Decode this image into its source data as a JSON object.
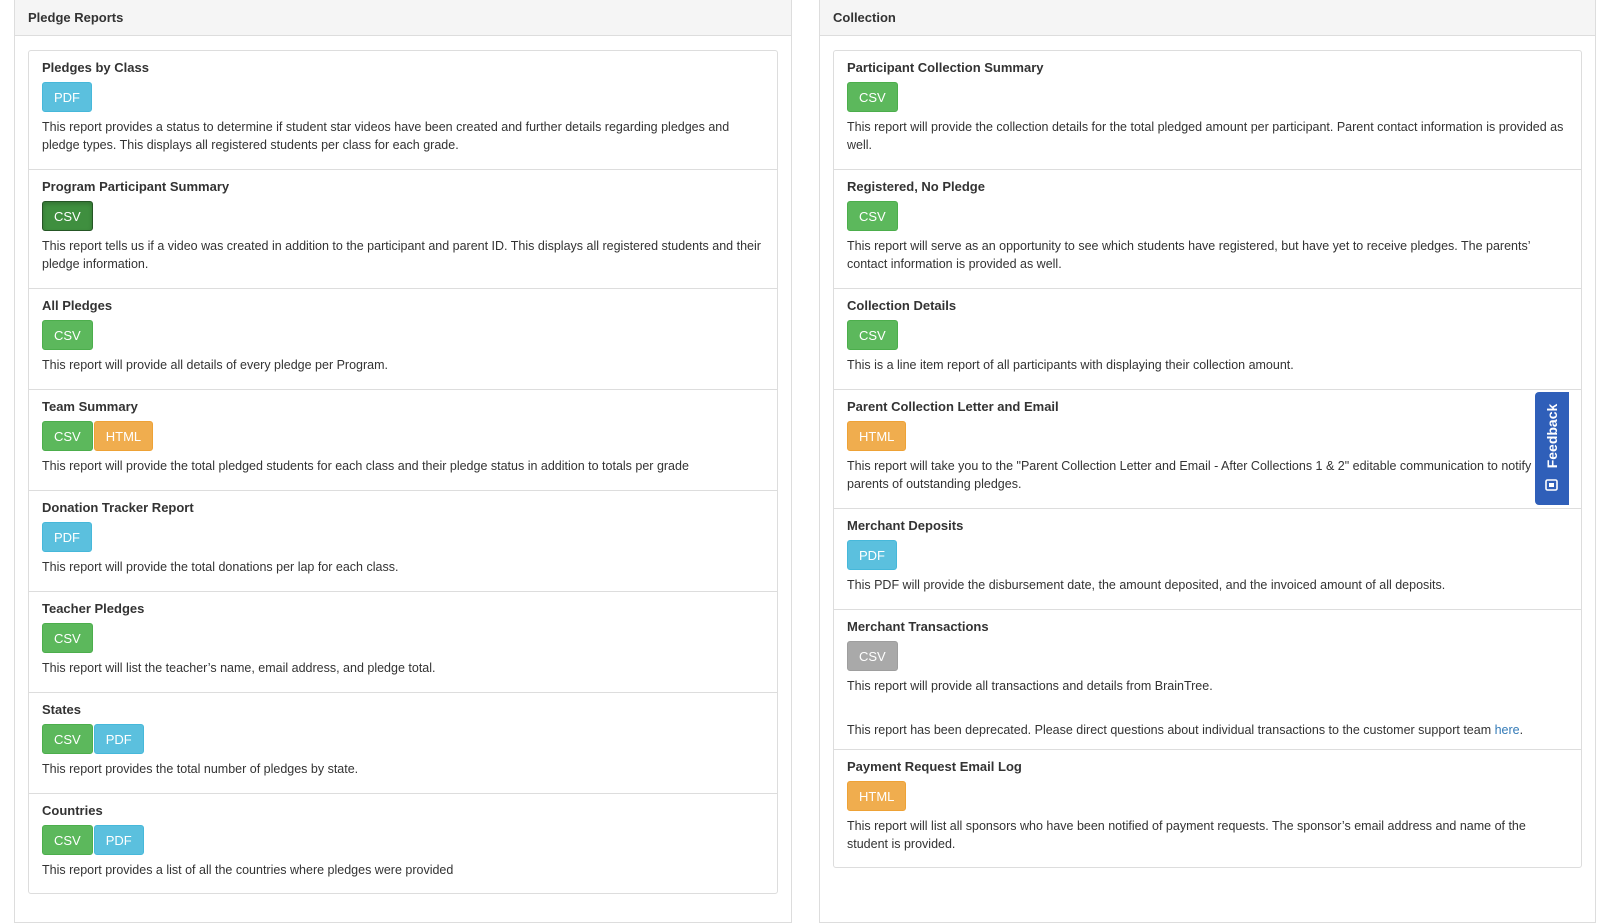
{
  "pledge_reports": {
    "title": "Pledge Reports",
    "items": [
      {
        "title": "Pledges by Class",
        "buttons": [
          {
            "label": "PDF",
            "kind": "pdf"
          }
        ],
        "desc": "This report provides a status to determine if student star videos have been created and further details regarding pledges and pledge types. This displays all registered students per class for each grade."
      },
      {
        "title": "Program Participant Summary",
        "buttons": [
          {
            "label": "CSV",
            "kind": "csv",
            "active": true
          }
        ],
        "desc": "This report tells us if a video was created in addition to the participant and parent ID. This displays all registered students and their pledge information."
      },
      {
        "title": "All Pledges",
        "buttons": [
          {
            "label": "CSV",
            "kind": "csv"
          }
        ],
        "desc": "This report will provide all details of every pledge per Program."
      },
      {
        "title": "Team Summary",
        "buttons": [
          {
            "label": "CSV",
            "kind": "csv"
          },
          {
            "label": "HTML",
            "kind": "html"
          }
        ],
        "desc": "This report will provide the total pledged students for each class and their pledge status in addition to totals per grade"
      },
      {
        "title": "Donation Tracker Report",
        "buttons": [
          {
            "label": "PDF",
            "kind": "pdf"
          }
        ],
        "desc": "This report will provide the total donations per lap for each class."
      },
      {
        "title": "Teacher Pledges",
        "buttons": [
          {
            "label": "CSV",
            "kind": "csv"
          }
        ],
        "desc": "This report will list the teacher’s name, email address, and pledge total."
      },
      {
        "title": "States",
        "buttons": [
          {
            "label": "CSV",
            "kind": "csv"
          },
          {
            "label": "PDF",
            "kind": "pdf"
          }
        ],
        "desc": "This report provides the total number of pledges by state."
      },
      {
        "title": "Countries",
        "buttons": [
          {
            "label": "CSV",
            "kind": "csv"
          },
          {
            "label": "PDF",
            "kind": "pdf"
          }
        ],
        "desc": "This report provides a list of all the countries where pledges were provided"
      }
    ]
  },
  "collection": {
    "title": "Collection",
    "items": [
      {
        "title": "Participant Collection Summary",
        "buttons": [
          {
            "label": "CSV",
            "kind": "csv"
          }
        ],
        "desc": "This report will provide the collection details for the total pledged amount per participant. Parent contact information is provided as well."
      },
      {
        "title": "Registered, No Pledge",
        "buttons": [
          {
            "label": "CSV",
            "kind": "csv"
          }
        ],
        "desc": "This report will serve as an opportunity to see which students have registered, but have yet to receive pledges. The parents’ contact information is provided as well."
      },
      {
        "title": "Collection Details",
        "buttons": [
          {
            "label": "CSV",
            "kind": "csv"
          }
        ],
        "desc": "This is a line item report of all participants with displaying their collection amount."
      },
      {
        "title": "Parent Collection Letter and Email",
        "buttons": [
          {
            "label": "HTML",
            "kind": "html"
          }
        ],
        "desc": "This report will take you to the \"Parent Collection Letter and Email - After Collections 1 & 2\" editable communication to notify parents of outstanding pledges."
      },
      {
        "title": "Merchant Deposits",
        "buttons": [
          {
            "label": "PDF",
            "kind": "pdf"
          }
        ],
        "desc": "This PDF will provide the disbursement date, the amount deposited, and the invoiced amount of all deposits."
      },
      {
        "title": "Merchant Transactions",
        "buttons": [
          {
            "label": "CSV",
            "kind": "disabled"
          }
        ],
        "desc": "This report will provide all transactions and details from BrainTree.",
        "note": {
          "text": "This report has been deprecated. Please direct questions about individual transactions to the customer support team ",
          "link": "here",
          "after": "."
        }
      },
      {
        "title": "Payment Request Email Log",
        "buttons": [
          {
            "label": "HTML",
            "kind": "html"
          }
        ],
        "desc": "This report will list all sponsors who have been notified of payment requests. The sponsor’s email address and name of the student is provided."
      }
    ]
  },
  "feedback": {
    "label": "Feedback",
    "icon": "feedback-icon"
  },
  "colors": {
    "csv": "#5cb85c",
    "pdf": "#5bc0de",
    "html": "#f0ad4e",
    "disabled": "#a9a9a9",
    "feedback": "#2f5fb9",
    "link": "#337ab7"
  }
}
